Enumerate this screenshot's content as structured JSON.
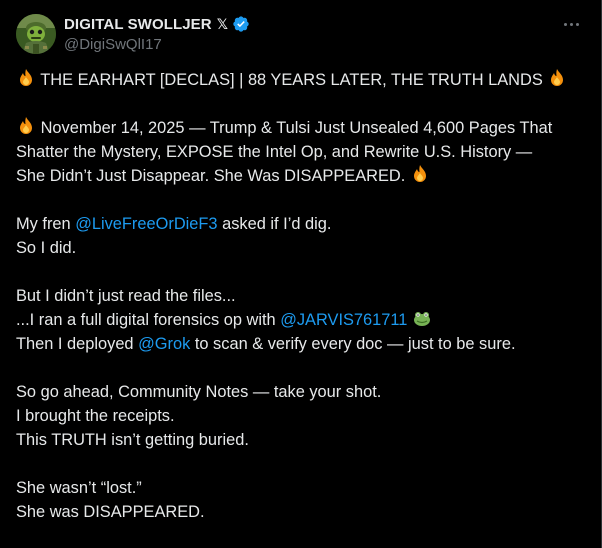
{
  "author": {
    "display_name": "DIGITAL SWOLLJER",
    "x_badge": "𝕏",
    "handle": "@DigiSwQlI17",
    "avatar_icon": "frog-soldier-avatar",
    "verified_icon": "verified-badge-icon"
  },
  "colors": {
    "background": "#000000",
    "text": "#e7e9ea",
    "muted": "#71767b",
    "link": "#1d9bf0",
    "verified": "#1d9bf0"
  },
  "post": {
    "title_pre": "THE EARHART [DECLAS] | 88 YEARS LATER, THE TRUTH LANDS",
    "p2_line1": "November 14, 2025 — Trump & Tulsi Just Unsealed 4,600 Pages That",
    "p2_line2": "Shatter the Mystery, EXPOSE the Intel Op, and Rewrite U.S. History —",
    "p2_line3": "She Didn’t Just Disappear. She Was DISAPPEARED.",
    "p3_l1_pre": "My fren ",
    "p3_l1_mention": "@LiveFreeOrDieF3",
    "p3_l1_post": " asked if I’d dig.",
    "p3_l2": "So I did.",
    "p4_l1": "But I didn’t just read the files...",
    "p4_l2_pre": "...I ran a full digital forensics op with ",
    "p4_l2_mention": "@JARVIS761711",
    "p4_l3_pre": "Then I deployed ",
    "p4_l3_mention": "@Grok",
    "p4_l3_post": " to scan & verify every doc — just to be sure.",
    "p5_l1": "So go ahead, Community Notes — take your shot.",
    "p5_l2": "I brought the receipts.",
    "p5_l3": "This TRUTH isn’t getting buried.",
    "p6_l1": "She wasn’t “lost.”",
    "p6_l2": "She was DISAPPEARED."
  }
}
